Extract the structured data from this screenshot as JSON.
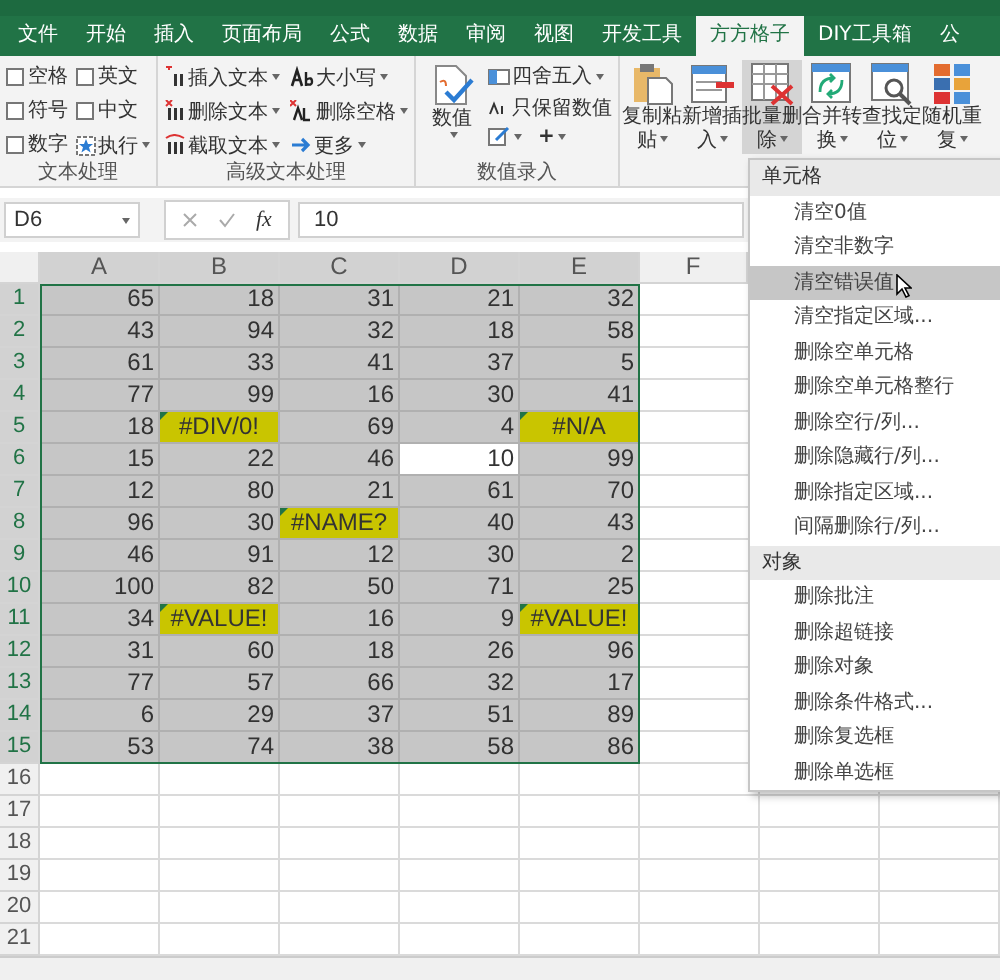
{
  "tabs": [
    {
      "label": "文件",
      "selected": false
    },
    {
      "label": "开始",
      "selected": false
    },
    {
      "label": "插入",
      "selected": false
    },
    {
      "label": "页面布局",
      "selected": false
    },
    {
      "label": "公式",
      "selected": false
    },
    {
      "label": "数据",
      "selected": false
    },
    {
      "label": "审阅",
      "selected": false
    },
    {
      "label": "视图",
      "selected": false
    },
    {
      "label": "开发工具",
      "selected": false
    },
    {
      "label": "方方格子",
      "selected": true
    },
    {
      "label": "DIY工具箱",
      "selected": false
    },
    {
      "label": "公",
      "selected": false
    }
  ],
  "ribbon": {
    "text_group": {
      "label": "文本处理",
      "checkboxes": [
        {
          "label": "空格",
          "checked": false
        },
        {
          "label": "英文",
          "checked": false
        },
        {
          "label": "符号",
          "checked": false
        },
        {
          "label": "中文",
          "checked": false
        },
        {
          "label": "数字",
          "checked": false
        }
      ],
      "run_button": "执行"
    },
    "advanced_group": {
      "label": "高级文本处理",
      "buttons": [
        "插入文本",
        "大小写",
        "删除文本",
        "删除空格",
        "截取文本",
        "更多"
      ]
    },
    "number_group": {
      "label": "数值录入",
      "big_button": "数值",
      "buttons": [
        "四舍五入",
        "只保留数值"
      ],
      "plus": "+"
    },
    "tools": [
      {
        "label": "复制粘贴",
        "selected": false
      },
      {
        "label": "新增插入",
        "selected": false
      },
      {
        "label": "批量删除",
        "selected": true
      },
      {
        "label": "合并转换",
        "selected": false
      },
      {
        "label": "查找定位",
        "selected": false
      },
      {
        "label": "随机重复",
        "selected": false
      }
    ]
  },
  "formula_bar": {
    "name_box": "D6",
    "fx": "fx",
    "value": "10"
  },
  "sheet": {
    "columns": [
      "A",
      "B",
      "C",
      "D",
      "E",
      "F"
    ],
    "rows": [
      {
        "header": "1",
        "cells": [
          {
            "text": "65",
            "kind": "number",
            "selected": false
          },
          {
            "text": "18",
            "kind": "number",
            "selected": false
          },
          {
            "text": "31",
            "kind": "number",
            "selected": false
          },
          {
            "text": "21",
            "kind": "number",
            "selected": false
          },
          {
            "text": "32",
            "kind": "number",
            "selected": false
          }
        ]
      },
      {
        "header": "2",
        "cells": [
          {
            "text": "43",
            "kind": "number",
            "selected": false
          },
          {
            "text": "94",
            "kind": "number",
            "selected": false
          },
          {
            "text": "32",
            "kind": "number",
            "selected": false
          },
          {
            "text": "18",
            "kind": "number",
            "selected": false
          },
          {
            "text": "58",
            "kind": "number",
            "selected": false
          }
        ]
      },
      {
        "header": "3",
        "cells": [
          {
            "text": "61",
            "kind": "number",
            "selected": false
          },
          {
            "text": "33",
            "kind": "number",
            "selected": false
          },
          {
            "text": "41",
            "kind": "number",
            "selected": false
          },
          {
            "text": "37",
            "kind": "number",
            "selected": false
          },
          {
            "text": "5",
            "kind": "number",
            "selected": false
          }
        ]
      },
      {
        "header": "4",
        "cells": [
          {
            "text": "77",
            "kind": "number",
            "selected": false
          },
          {
            "text": "99",
            "kind": "number",
            "selected": false
          },
          {
            "text": "16",
            "kind": "number",
            "selected": false
          },
          {
            "text": "30",
            "kind": "number",
            "selected": false
          },
          {
            "text": "41",
            "kind": "number",
            "selected": false
          }
        ]
      },
      {
        "header": "5",
        "cells": [
          {
            "text": "18",
            "kind": "number",
            "selected": false
          },
          {
            "text": "#DIV/0!",
            "kind": "error",
            "selected": false
          },
          {
            "text": "69",
            "kind": "number",
            "selected": false
          },
          {
            "text": "4",
            "kind": "number",
            "selected": false
          },
          {
            "text": "#N/A",
            "kind": "error",
            "selected": false
          }
        ]
      },
      {
        "header": "6",
        "cells": [
          {
            "text": "15",
            "kind": "number",
            "selected": false
          },
          {
            "text": "22",
            "kind": "number",
            "selected": false
          },
          {
            "text": "46",
            "kind": "number",
            "selected": false
          },
          {
            "text": "10",
            "kind": "number",
            "selected": true
          },
          {
            "text": "99",
            "kind": "number",
            "selected": false
          }
        ]
      },
      {
        "header": "7",
        "cells": [
          {
            "text": "12",
            "kind": "number",
            "selected": false
          },
          {
            "text": "80",
            "kind": "number",
            "selected": false
          },
          {
            "text": "21",
            "kind": "number",
            "selected": false
          },
          {
            "text": "61",
            "kind": "number",
            "selected": false
          },
          {
            "text": "70",
            "kind": "number",
            "selected": false
          }
        ]
      },
      {
        "header": "8",
        "cells": [
          {
            "text": "96",
            "kind": "number",
            "selected": false
          },
          {
            "text": "30",
            "kind": "number",
            "selected": false
          },
          {
            "text": "#NAME?",
            "kind": "error",
            "selected": false
          },
          {
            "text": "40",
            "kind": "number",
            "selected": false
          },
          {
            "text": "43",
            "kind": "number",
            "selected": false
          }
        ]
      },
      {
        "header": "9",
        "cells": [
          {
            "text": "46",
            "kind": "number",
            "selected": false
          },
          {
            "text": "91",
            "kind": "number",
            "selected": false
          },
          {
            "text": "12",
            "kind": "number",
            "selected": false
          },
          {
            "text": "30",
            "kind": "number",
            "selected": false
          },
          {
            "text": "2",
            "kind": "number",
            "selected": false
          }
        ]
      },
      {
        "header": "10",
        "cells": [
          {
            "text": "100",
            "kind": "number",
            "selected": false
          },
          {
            "text": "82",
            "kind": "number",
            "selected": false
          },
          {
            "text": "50",
            "kind": "number",
            "selected": false
          },
          {
            "text": "71",
            "kind": "number",
            "selected": false
          },
          {
            "text": "25",
            "kind": "number",
            "selected": false
          }
        ]
      },
      {
        "header": "11",
        "cells": [
          {
            "text": "34",
            "kind": "number",
            "selected": false
          },
          {
            "text": "#VALUE!",
            "kind": "error",
            "selected": false
          },
          {
            "text": "16",
            "kind": "number",
            "selected": false
          },
          {
            "text": "9",
            "kind": "number",
            "selected": false
          },
          {
            "text": "#VALUE!",
            "kind": "error",
            "selected": false
          }
        ]
      },
      {
        "header": "12",
        "cells": [
          {
            "text": "31",
            "kind": "number",
            "selected": false
          },
          {
            "text": "60",
            "kind": "number",
            "selected": false
          },
          {
            "text": "18",
            "kind": "number",
            "selected": false
          },
          {
            "text": "26",
            "kind": "number",
            "selected": false
          },
          {
            "text": "96",
            "kind": "number",
            "selected": false
          }
        ]
      },
      {
        "header": "13",
        "cells": [
          {
            "text": "77",
            "kind": "number",
            "selected": false
          },
          {
            "text": "57",
            "kind": "number",
            "selected": false
          },
          {
            "text": "66",
            "kind": "number",
            "selected": false
          },
          {
            "text": "32",
            "kind": "number",
            "selected": false
          },
          {
            "text": "17",
            "kind": "number",
            "selected": false
          }
        ]
      },
      {
        "header": "14",
        "cells": [
          {
            "text": "6",
            "kind": "number",
            "selected": false
          },
          {
            "text": "29",
            "kind": "number",
            "selected": false
          },
          {
            "text": "37",
            "kind": "number",
            "selected": false
          },
          {
            "text": "51",
            "kind": "number",
            "selected": false
          },
          {
            "text": "89",
            "kind": "number",
            "selected": false
          }
        ]
      },
      {
        "header": "15",
        "cells": [
          {
            "text": "53",
            "kind": "number",
            "selected": false
          },
          {
            "text": "74",
            "kind": "number",
            "selected": false
          },
          {
            "text": "38",
            "kind": "number",
            "selected": false
          },
          {
            "text": "58",
            "kind": "number",
            "selected": false
          },
          {
            "text": "86",
            "kind": "number",
            "selected": false
          }
        ]
      },
      {
        "header": "16"
      },
      {
        "header": "17"
      },
      {
        "header": "18"
      },
      {
        "header": "19"
      },
      {
        "header": "20"
      },
      {
        "header": "21"
      }
    ]
  },
  "menu": {
    "sections": [
      {
        "title": "单元格",
        "items": [
          {
            "label": "清空0值",
            "selected": false
          },
          {
            "label": "清空非数字",
            "selected": false
          },
          {
            "label": "清空错误值",
            "selected": true
          },
          {
            "label": "清空指定区域...",
            "selected": false
          },
          {
            "label": "删除空单元格",
            "selected": false
          },
          {
            "label": "删除空单元格整行",
            "selected": false
          },
          {
            "label": "删除空行/列...",
            "selected": false
          },
          {
            "label": "删除隐藏行/列...",
            "selected": false
          },
          {
            "label": "删除指定区域...",
            "selected": false
          },
          {
            "label": "间隔删除行/列...",
            "selected": false
          }
        ]
      },
      {
        "title": "对象",
        "items": [
          {
            "label": "删除批注",
            "selected": false
          },
          {
            "label": "删除超链接",
            "selected": false
          },
          {
            "label": "删除对象",
            "selected": false
          },
          {
            "label": "删除条件格式...",
            "selected": false
          },
          {
            "label": "删除复选框",
            "selected": false
          },
          {
            "label": "删除单选框",
            "selected": false
          }
        ]
      }
    ]
  }
}
